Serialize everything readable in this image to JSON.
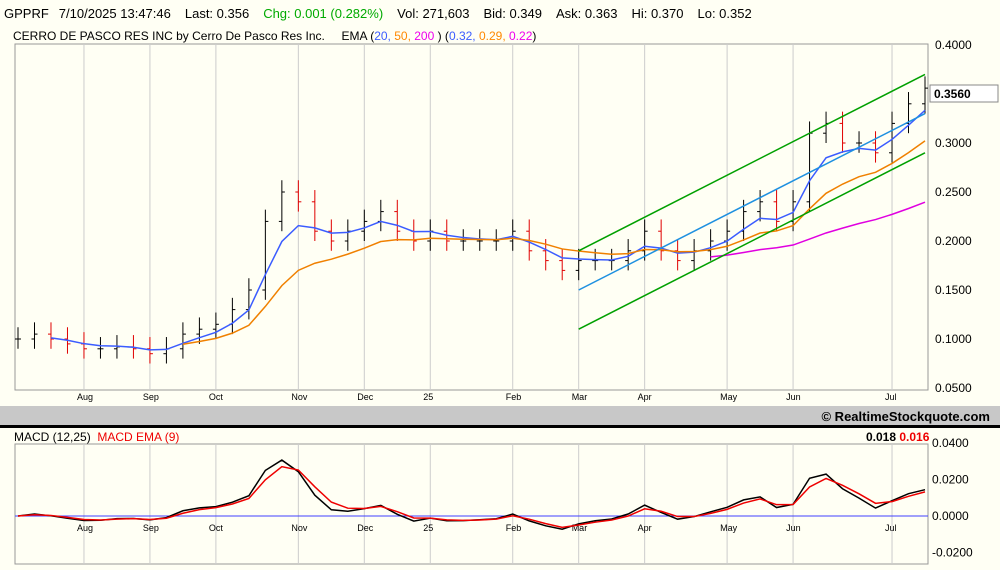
{
  "quote": {
    "symbol": "GPPRF",
    "datetime": "7/10/2025 13:47:46",
    "last": "Last: 0.356",
    "chg": "Chg: 0.001 (0.282%)",
    "vol": "Vol: 271,603",
    "bid": "Bid: 0.349",
    "ask": "Ask: 0.363",
    "hi": "Hi: 0.370",
    "lo": "Lo: 0.352"
  },
  "header": {
    "name": "CERRO DE PASCO RES INC by Cerro De Pasco Res Inc.",
    "ema_label": "EMA (",
    "p1": "20,",
    "p2": " 50,",
    "p3": " 200",
    "mid": " )  (",
    "v1": "0.32,",
    "v2": " 0.29,",
    "v3": " 0.22",
    "end": ")"
  },
  "copyright": "© RealtimeStockquote.com",
  "macd": {
    "label": "MACD (12,25)",
    "ema_label": "MACD EMA (9)",
    "value": "0.018",
    "ema_value": "0.016"
  },
  "colors": {
    "ema20": "#3b5cff",
    "ema50": "#f08000",
    "ema200": "#e000e0",
    "channel": "#00a000",
    "mid": "#1e90e0",
    "up": "#000000",
    "down": "#e00000"
  },
  "chart_data": {
    "type": "line",
    "title": "GPPRF daily price",
    "ylim": [
      0.05,
      0.4
    ],
    "y_ticks": [
      "0.4000",
      "0.3500",
      "0.3000",
      "0.2500",
      "0.2000",
      "0.1500",
      "0.1000",
      "0.0500"
    ],
    "last_price_label": "0.3560",
    "x_ticks": [
      {
        "label": "Aug",
        "i": 4
      },
      {
        "label": "Sep",
        "i": 8
      },
      {
        "label": "Oct",
        "i": 12
      },
      {
        "label": "Nov",
        "i": 17
      },
      {
        "label": "Dec",
        "i": 21
      },
      {
        "label": "25",
        "i": 25
      },
      {
        "label": "Feb",
        "i": 30
      },
      {
        "label": "Mar",
        "i": 34
      },
      {
        "label": "Apr",
        "i": 38
      },
      {
        "label": "May",
        "i": 43
      },
      {
        "label": "Jun",
        "i": 47
      },
      {
        "label": "Jul",
        "i": 53
      }
    ],
    "closes": [
      0.1,
      0.105,
      0.1,
      0.095,
      0.09,
      0.09,
      0.092,
      0.09,
      0.085,
      0.09,
      0.105,
      0.11,
      0.115,
      0.13,
      0.15,
      0.22,
      0.25,
      0.24,
      0.21,
      0.2,
      0.21,
      0.22,
      0.23,
      0.21,
      0.2,
      0.21,
      0.2,
      0.2,
      0.2,
      0.2,
      0.21,
      0.19,
      0.18,
      0.17,
      0.18,
      0.18,
      0.18,
      0.19,
      0.21,
      0.19,
      0.18,
      0.19,
      0.2,
      0.21,
      0.23,
      0.24,
      0.22,
      0.24,
      0.31,
      0.32,
      0.3,
      0.3,
      0.29,
      0.32,
      0.34,
      0.356
    ],
    "trendlines": [
      {
        "name": "channel-upper",
        "from": [
          34,
          0.19
        ],
        "to": [
          55,
          0.37
        ]
      },
      {
        "name": "channel-lower",
        "from": [
          34,
          0.11
        ],
        "to": [
          55,
          0.29
        ]
      },
      {
        "name": "channel-mid",
        "from": [
          34,
          0.15
        ],
        "to": [
          55,
          0.33
        ]
      }
    ],
    "macd_ylim": [
      -0.025,
      0.045
    ],
    "macd_ticks": [
      "0.0400",
      "0.0200",
      "0.0000",
      "-0.0200"
    ]
  }
}
